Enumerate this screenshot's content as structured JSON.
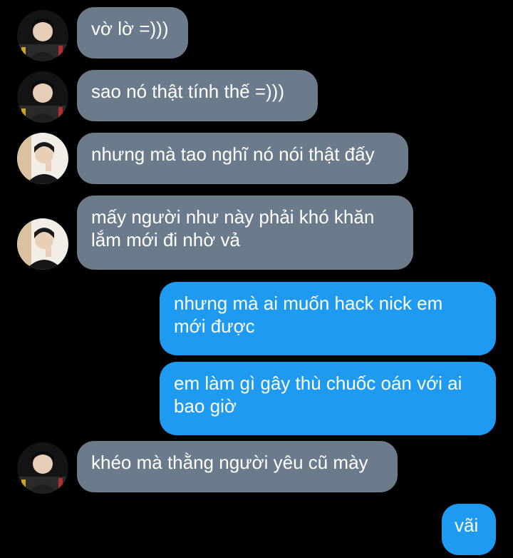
{
  "conversation": {
    "messages": [
      {
        "sender": "other",
        "avatar": "avatar-dark-profile",
        "text": "vờ lờ =)))"
      },
      {
        "sender": "other",
        "avatar": "avatar-dark-profile",
        "text": "sao nó thật tính thế =)))"
      },
      {
        "sender": "other",
        "avatar": "avatar-light-profile",
        "text": "nhưng mà tao nghĩ nó nói thật đấy"
      },
      {
        "sender": "other",
        "avatar": "avatar-light-profile",
        "text": "mấy người như này phải khó khăn\nlắm mới đi nhờ vả"
      },
      {
        "sender": "me",
        "text": "nhưng mà ai muốn hack nick em\nmới được"
      },
      {
        "sender": "me",
        "text": "em làm gì gây thù chuốc oán với ai\nbao giờ"
      },
      {
        "sender": "other",
        "avatar": "avatar-dark-profile",
        "text": "khéo mà thằng người yêu cũ mày"
      },
      {
        "sender": "me",
        "text": "vãi"
      }
    ]
  },
  "colors": {
    "background": "#000000",
    "incoming_bubble": "#6b7b8c",
    "outgoing_bubble": "#1e9bf0",
    "text": "#ffffff"
  }
}
